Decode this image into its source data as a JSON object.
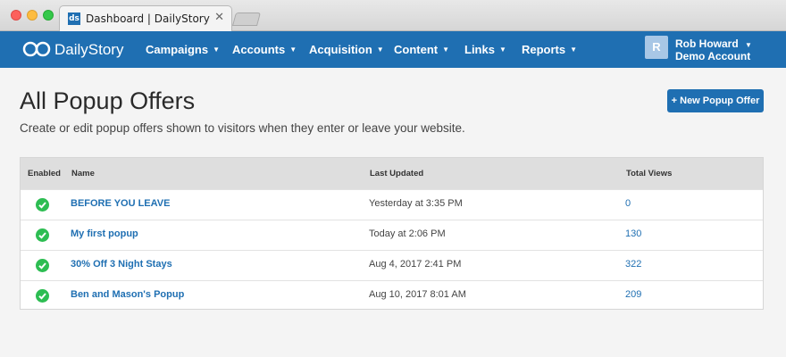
{
  "browser": {
    "tab_title": "Dashboard | DailyStory",
    "tab_favicon_text": "ds",
    "tab_close": "✕"
  },
  "navbar": {
    "brand": "DailyStory",
    "items": [
      {
        "label": "Campaigns"
      },
      {
        "label": "Accounts"
      },
      {
        "label": "Acquisition"
      },
      {
        "label": "Content"
      },
      {
        "label": "Links"
      },
      {
        "label": "Reports"
      }
    ],
    "caret": "▼",
    "user": {
      "initial": "R",
      "name": "Rob Howard",
      "account": "Demo Account"
    }
  },
  "page": {
    "title": "All Popup Offers",
    "description": "Create or edit popup offers shown to visitors when they enter or leave your website.",
    "new_button": "+ New Popup Offer"
  },
  "table": {
    "headers": {
      "enabled": "Enabled",
      "name": "Name",
      "last_updated": "Last Updated",
      "total_views": "Total Views"
    },
    "rows": [
      {
        "enabled": true,
        "name": "BEFORE YOU LEAVE",
        "last_updated": "Yesterday at 3:35 PM",
        "total_views": "0"
      },
      {
        "enabled": true,
        "name": "My first popup",
        "last_updated": "Today at 2:06 PM",
        "total_views": "130"
      },
      {
        "enabled": true,
        "name": "30% Off 3 Night Stays",
        "last_updated": "Aug 4, 2017 2:41 PM",
        "total_views": "322"
      },
      {
        "enabled": true,
        "name": "Ben and Mason's Popup",
        "last_updated": "Aug 10, 2017 8:01 AM",
        "total_views": "209"
      }
    ]
  },
  "colors": {
    "brand_blue": "#1f6fb2",
    "enabled_green": "#2dbd52",
    "page_bg": "#f4f4f4"
  }
}
